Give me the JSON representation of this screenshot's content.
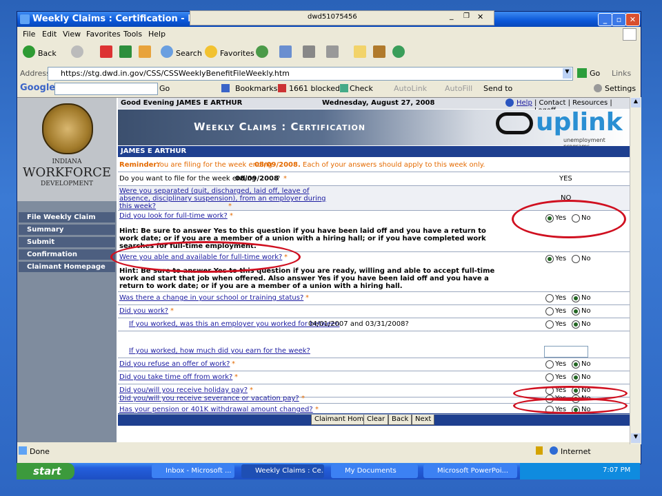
{
  "window": {
    "title": "Weekly Claims : Certification - Microsoft",
    "popup_title": "dwd51075456"
  },
  "menu": [
    "File",
    "Edit",
    "View",
    "Favorites",
    "Tools",
    "Help"
  ],
  "toolbar": {
    "back": "Back",
    "search": "Search",
    "favorites": "Favorites"
  },
  "address": {
    "label": "Address",
    "url": "https://stg.dwd.in.gov/CSS/CSSWeeklyBenefitFileWeekly.htm",
    "go": "Go",
    "links": "Links"
  },
  "google": {
    "go": "Go",
    "bookmarks": "Bookmarks",
    "blocked": "1661 blocked",
    "check": "Check",
    "autolink": "AutoLink",
    "autofill": "AutoFill",
    "sendto": "Send to",
    "settings": "Settings"
  },
  "header": {
    "greeting": "Good Evening JAMES E ARTHUR",
    "date": "Wednesday, August 27, 2008",
    "help": "Help",
    "contact": "| Contact | Resources | Logoff"
  },
  "banner": {
    "title": "Weekly Claims : Certification",
    "brand": "uplink",
    "brand_sub": "unemployment programs"
  },
  "logo": {
    "indiana": "INDIANA",
    "workforce": "WORKFORCE",
    "development": "DEVELOPMENT"
  },
  "sidebar": [
    "File Weekly Claim",
    "Summary",
    "Submit",
    "Confirmation",
    "Claimant Homepage"
  ],
  "claimant_name": "JAMES E ARTHUR",
  "reminder": {
    "label": "Reminder:",
    "text": "You are filing for the week ending",
    "date": "08/09/2008.",
    "tail": "Each of your answers should apply to this week only."
  },
  "questions": [
    {
      "text": "Do you want to file for the week ending",
      "bold": "08/09/2008",
      "tail": "?",
      "answer": "YES"
    },
    {
      "text": "Were you separated (quit, discharged, laid off, leave of absence, disciplinary suspension), from an employer during this week?",
      "answer": "NO"
    },
    {
      "text": "Did you look for full-time work?",
      "selected": "Yes"
    },
    {
      "text": "Were you able and available for full-time work?",
      "selected": "Yes"
    },
    {
      "text": "Was there a change in your school or training status?",
      "selected": "No"
    },
    {
      "text": "Did you work?",
      "selected": "No"
    },
    {
      "text": "If you worked, was this an employer you worked for between",
      "tail": "04/01/2007 and 03/31/2008?",
      "selected": "No"
    },
    {
      "text": "If you worked, how much did you earn for the week?"
    },
    {
      "text": "Did you refuse an offer of work?",
      "selected": "No"
    },
    {
      "text": "Did you take time off from work?",
      "selected": "No"
    },
    {
      "text": "Did you/will you receive holiday pay?",
      "selected": "No"
    },
    {
      "text": "Did you/will you receive severance or vacation pay?",
      "selected": "No"
    },
    {
      "text": "Has your pension or 401K withdrawal amount changed?",
      "selected": "No"
    }
  ],
  "hints": [
    "Hint: Be sure to answer Yes to this question if you have been laid off and you have a return to work date; or if you are a member of a union with a hiring hall; or if you have completed work searches for full-time employment.",
    "Hint: Be sure to answer Yes to this question if you are ready, willing and able to accept full-time work and start that job when offered. Also answer Yes if you have been laid off and you have a return to work date; or if you are a member of a union with a hiring hall."
  ],
  "radio_labels": {
    "yes": "Yes",
    "no": "No"
  },
  "buttons": [
    "Claimant Home",
    "Clear",
    "Back",
    "Next"
  ],
  "status": {
    "left": "Done",
    "zone": "Internet"
  },
  "taskbar": {
    "start": "start",
    "items": [
      "Inbox - Microsoft ...",
      "Weekly Claims : Ce...",
      "My Documents",
      "Microsoft PowerPoi..."
    ],
    "clock": "7:07 PM"
  }
}
